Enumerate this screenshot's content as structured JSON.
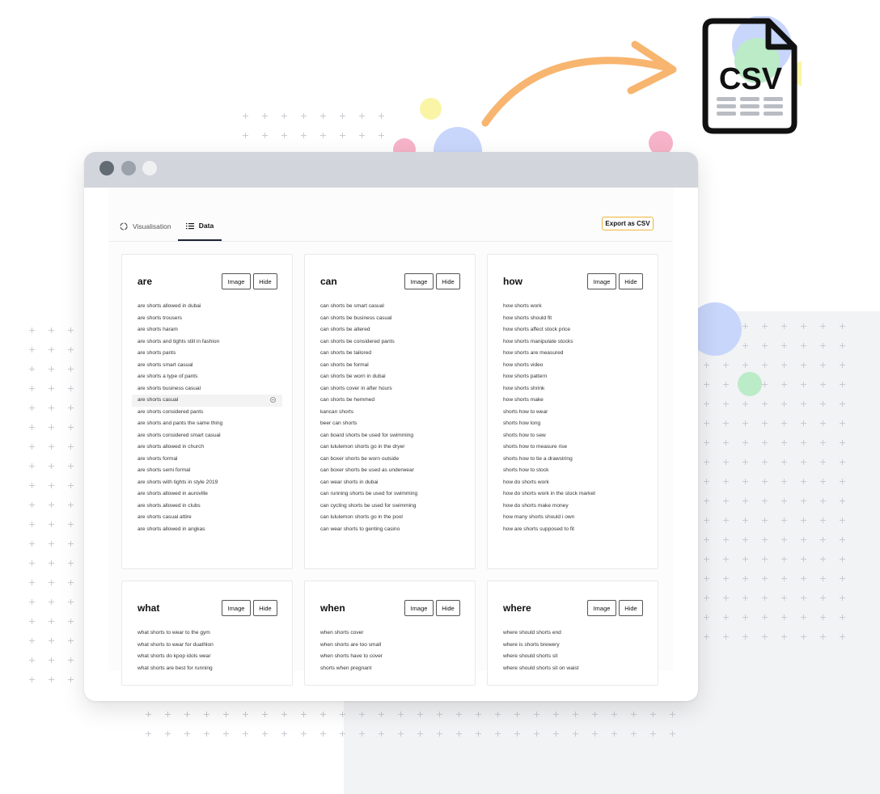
{
  "tabs": {
    "visualisation": "Visualisation",
    "data": "Data"
  },
  "export_button": "Export as CSV",
  "csv_icon_label": "CSV",
  "colors": {
    "accent_export": "#f0b43c",
    "arrow": "#f8b56f",
    "titlebar": "#d2d6dc",
    "window_dots": [
      "#626b74",
      "#9ca2aa",
      "#eef0f2"
    ]
  },
  "cards": [
    {
      "title": "are",
      "image_label": "Image",
      "hide_label": "Hide",
      "highlighted_index": 8,
      "items": [
        "are shorts allowed in dubai",
        "are shorts trousers",
        "are shorts haram",
        "are shorts and tights still in fashion",
        "are shorts pants",
        "are shorts smart casual",
        "are shorts a type of pants",
        "are shorts business casual",
        "are shorts casual",
        "are shorts considered pants",
        "are shorts and pants the same thing",
        "are shorts considered smart casual",
        "are shorts allowed in church",
        "are shorts formal",
        "are shorts semi formal",
        "are shorts with tights in style 2019",
        "are shorts allowed in auroville",
        "are shorts allowed in clubs",
        "are shorts casual attire",
        "are shorts allowed in angkas"
      ]
    },
    {
      "title": "can",
      "image_label": "Image",
      "hide_label": "Hide",
      "items": [
        "can shorts be smart casual",
        "can shorts be business casual",
        "can shorts be altered",
        "can shorts be considered pants",
        "can shorts be tailored",
        "can shorts be formal",
        "can shorts be worn in dubai",
        "can shorts cover in after hours",
        "can shorts be hemmed",
        "kancan shorts",
        "beer can shorts",
        "can board shorts be used for swimming",
        "can lululemon shorts go in the dryer",
        "can boxer shorts be worn outside",
        "can boxer shorts be used as underwear",
        "can wear shorts in dubai",
        "can running shorts be used for swimming",
        "can cycling shorts be used for swimming",
        "can lululemon shorts go in the pool",
        "can wear shorts to genting casino"
      ]
    },
    {
      "title": "how",
      "image_label": "Image",
      "hide_label": "Hide",
      "items": [
        "how shorts work",
        "how shorts should fit",
        "how shorts affect stock price",
        "how shorts manipulate stocks",
        "how shorts are measured",
        "how shorts video",
        "how shorts pattern",
        "how shorts shrink",
        "how shorts make",
        "shorts how to wear",
        "shorts how long",
        "shorts how to sew",
        "shorts how to measure rise",
        "shorts how to tie a drawstring",
        "shorts how to stock",
        "how do shorts work",
        "how do shorts work in the stock market",
        "how do shorts make money",
        "how many shorts should i own",
        "how are shorts supposed to fit"
      ]
    },
    {
      "title": "what",
      "image_label": "Image",
      "hide_label": "Hide",
      "items": [
        "what shorts to wear to the gym",
        "what shorts to wear for duathlon",
        "what shorts do kpop idols wear",
        "what shorts are best for running"
      ]
    },
    {
      "title": "when",
      "image_label": "Image",
      "hide_label": "Hide",
      "items": [
        "when shorts cover",
        "when shorts are too small",
        "when shorts have to cover",
        "shorts when pregnant"
      ]
    },
    {
      "title": "where",
      "image_label": "Image",
      "hide_label": "Hide",
      "items": [
        "where should shorts end",
        "where is shorts brewery",
        "where should shorts sit",
        "where should shorts sit on waist"
      ]
    }
  ]
}
